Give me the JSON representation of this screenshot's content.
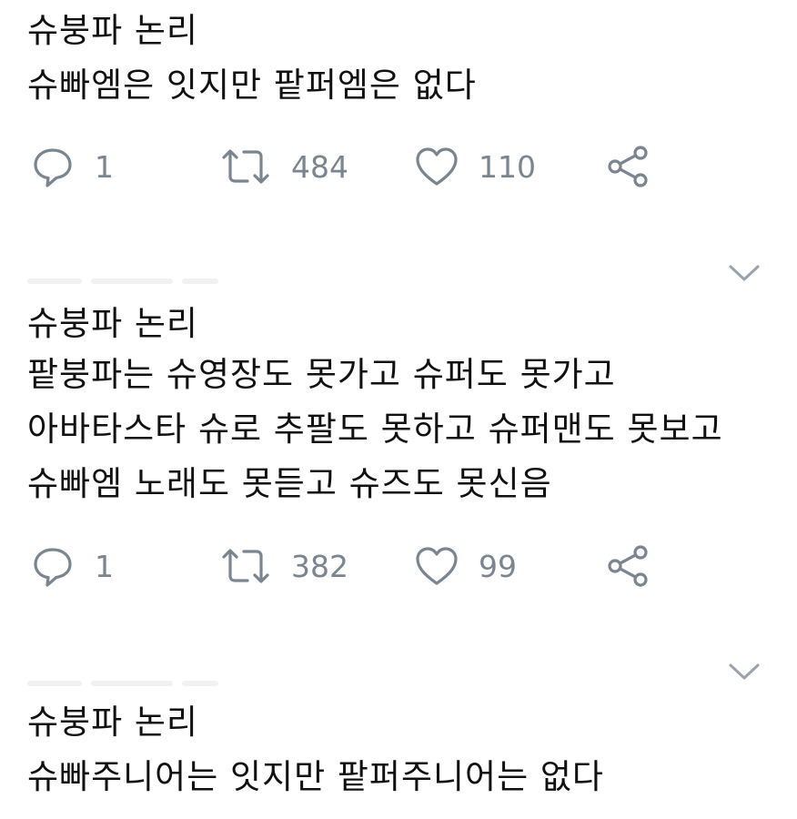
{
  "tweets": [
    {
      "lines": [
        "슈붕파 논리",
        "슈빠엠은 잇지만 팥퍼엠은 없다"
      ],
      "reply_count": "1",
      "retweet_count": "484",
      "like_count": "110"
    },
    {
      "lines": [
        "슈붕파 논리",
        "팥붕파는 슈영장도 못가고 슈퍼도 못가고",
        "아바타스타 슈로 추팔도 못하고 슈퍼맨도 못보고",
        "슈빠엠 노래도 못듣고 슈즈도 못신음"
      ],
      "reply_count": "1",
      "retweet_count": "382",
      "like_count": "99"
    },
    {
      "lines": [
        "슈붕파 논리",
        "슈빠주니어는 잇지만 팥퍼주니어는 없다"
      ]
    }
  ],
  "icons": {
    "reply": "speech-bubble-icon",
    "retweet": "retweet-icon",
    "like": "heart-icon",
    "share": "share-icon",
    "more": "chevron-down-icon"
  },
  "colors": {
    "icon": "#7a8590",
    "text": "#111111",
    "background": "#ffffff"
  }
}
